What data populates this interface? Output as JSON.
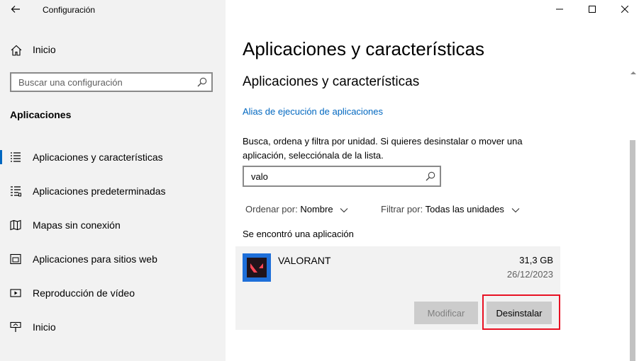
{
  "window": {
    "title": "Configuración"
  },
  "sidebar": {
    "home_label": "Inicio",
    "search_placeholder": "Buscar una configuración",
    "section_title": "Aplicaciones",
    "items": [
      {
        "label": "Aplicaciones y características",
        "icon": "list-icon",
        "active": true
      },
      {
        "label": "Aplicaciones predeterminadas",
        "icon": "default-apps-icon",
        "active": false
      },
      {
        "label": "Mapas sin conexión",
        "icon": "map-icon",
        "active": false
      },
      {
        "label": "Aplicaciones para sitios web",
        "icon": "website-icon",
        "active": false
      },
      {
        "label": "Reproducción de vídeo",
        "icon": "video-icon",
        "active": false
      },
      {
        "label": "Inicio",
        "icon": "startup-icon",
        "active": false
      }
    ]
  },
  "main": {
    "page_title": "Aplicaciones y características",
    "sub_title": "Aplicaciones y características",
    "alias_link": "Alias de ejecución de aplicaciones",
    "description": "Busca, ordena y filtra por unidad. Si quieres desinstalar o mover una aplicación, selecciónala de la lista.",
    "filter_value": "valo",
    "sort_label": "Ordenar por:",
    "sort_value": "Nombre",
    "filter_label": "Filtrar por:",
    "filter_drive": "Todas las unidades",
    "found_text": "Se encontró una aplicación",
    "app": {
      "name": "VALORANT",
      "size": "31,3 GB",
      "date": "26/12/2023",
      "modify_label": "Modificar",
      "uninstall_label": "Desinstalar"
    }
  },
  "colors": {
    "accent": "#0067c0",
    "highlight": "#e81123",
    "sidebar_bg": "#f2f2f2",
    "app_icon_bg": "#1e6fd9",
    "valorant_red": "#ff4655"
  }
}
